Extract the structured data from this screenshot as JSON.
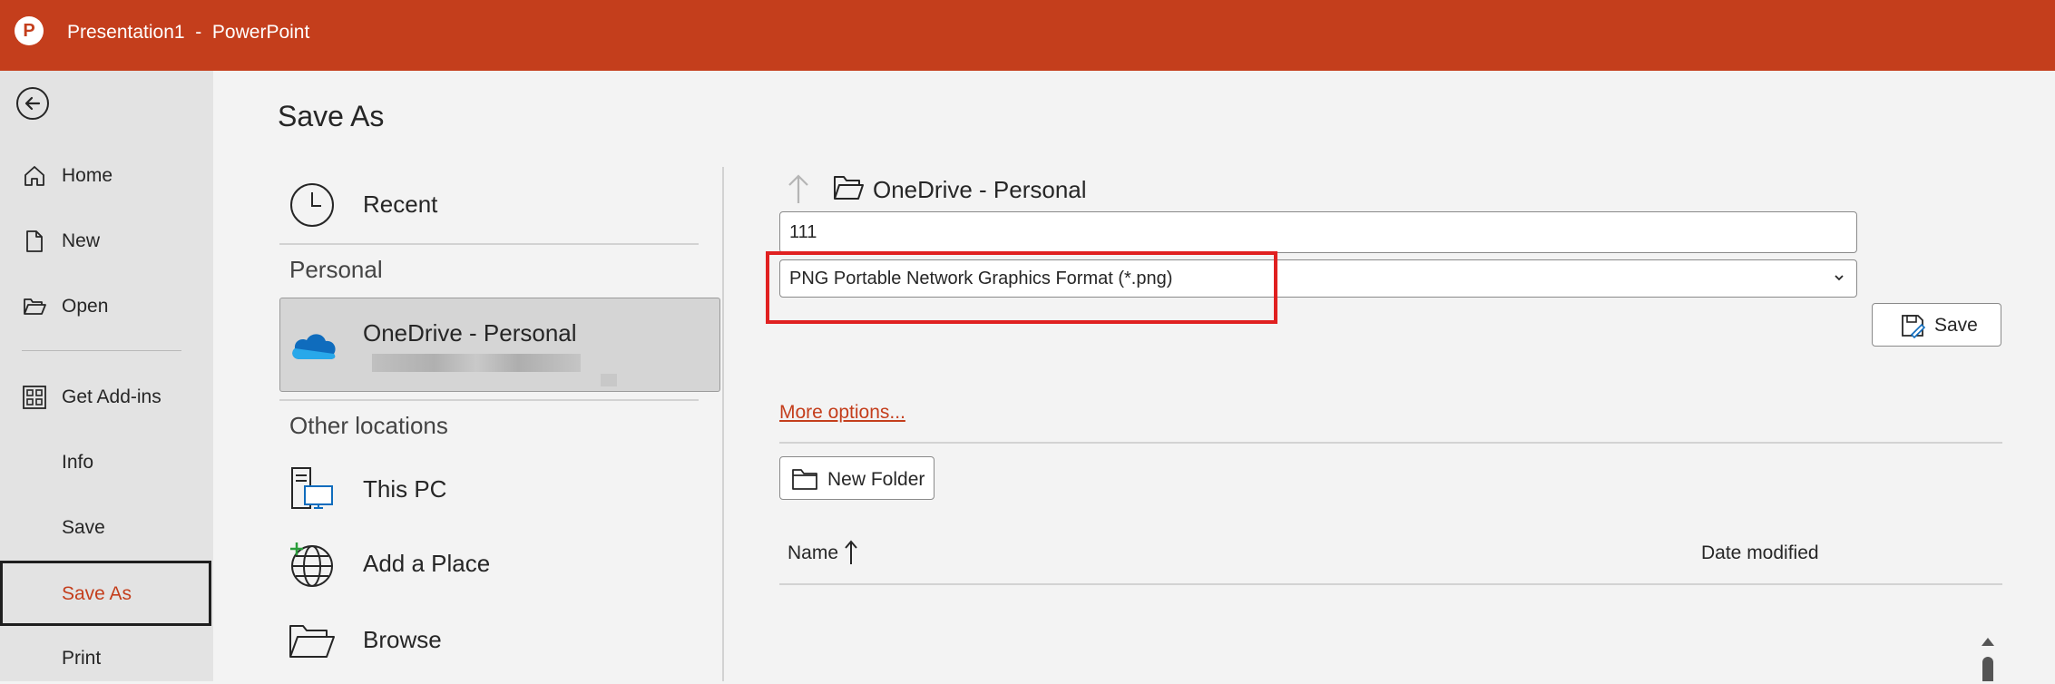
{
  "titlebar": {
    "app_icon": "powerpoint-logo",
    "title": "Presentation1  -  PowerPoint",
    "color": "#c43e1c"
  },
  "nav": {
    "back_icon": "back-arrow-icon",
    "items": [
      {
        "label": "Home",
        "icon": "home-icon"
      },
      {
        "label": "New",
        "icon": "document-icon"
      },
      {
        "label": "Open",
        "icon": "open-folder-icon"
      },
      {
        "label": "Get Add-ins",
        "icon": "grid-icon"
      },
      {
        "label": "Info"
      },
      {
        "label": "Save"
      },
      {
        "label": "Save As",
        "selected": true
      },
      {
        "label": "Print"
      }
    ]
  },
  "page": {
    "title": "Save As"
  },
  "locations": {
    "recent": "Recent",
    "personal_header": "Personal",
    "onedrive": "OneDrive - Personal",
    "other_header": "Other locations",
    "this_pc": "This PC",
    "add_place": "Add a Place",
    "browse": "Browse"
  },
  "save_panel": {
    "path": "OneDrive - Personal",
    "filename": "111",
    "filetype": "PNG Portable Network Graphics Format (*.png)",
    "save_label": "Save",
    "more_options": "More options...",
    "new_folder": "New Folder",
    "col_name": "Name",
    "col_date": "Date modified",
    "highlight_color": "#e02020"
  }
}
